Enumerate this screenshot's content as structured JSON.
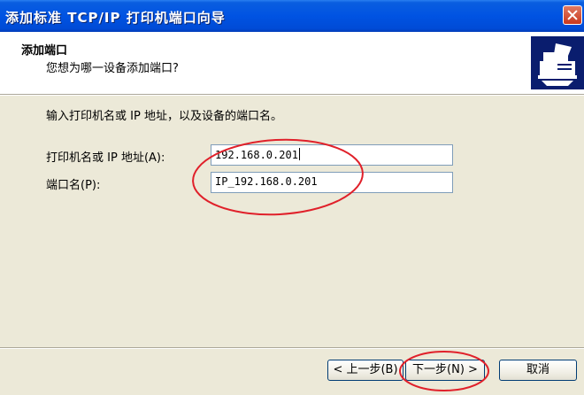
{
  "window": {
    "title": "添加标准 TCP/IP 打印机端口向导"
  },
  "header": {
    "title": "添加端口",
    "subtitle": "您想为哪一设备添加端口?"
  },
  "main": {
    "instruction": "输入打印机名或 IP 地址，以及设备的端口名。",
    "fields": [
      {
        "label": "打印机名或 IP 地址(A):",
        "value": "192.168.0.201"
      },
      {
        "label": "端口名(P):",
        "value": "IP_192.168.0.201"
      }
    ]
  },
  "buttons": {
    "back": "< 上一步(B)",
    "next": "下一步(N) >",
    "cancel": "取消"
  },
  "icons": {
    "close": "close-icon",
    "printer": "printer-icon"
  },
  "colors": {
    "annotation": "#e0202a",
    "titlebar": "#0053e2"
  }
}
